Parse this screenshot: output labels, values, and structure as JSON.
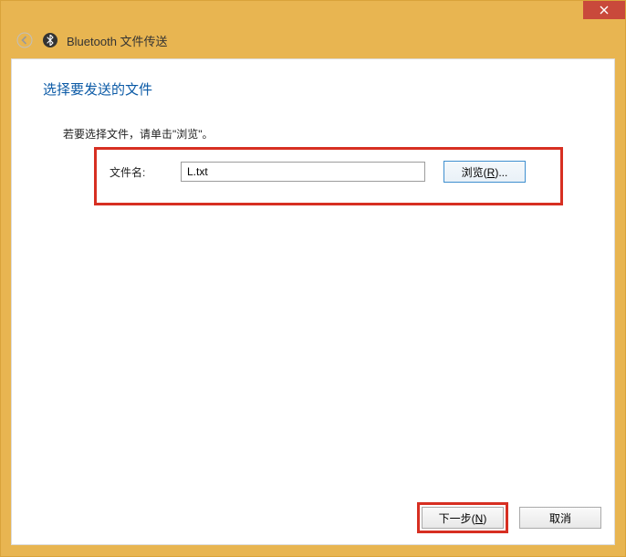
{
  "window": {
    "title": "Bluetooth 文件传送"
  },
  "page": {
    "heading": "选择要发送的文件",
    "instruction": "若要选择文件，请单击\"浏览\"。"
  },
  "file": {
    "label": "文件名:",
    "value": "L.txt",
    "browse_prefix": "浏览(",
    "browse_key": "R",
    "browse_suffix": ")..."
  },
  "footer": {
    "next_prefix": "下一步(",
    "next_key": "N",
    "next_suffix": ")",
    "cancel": "取消"
  }
}
